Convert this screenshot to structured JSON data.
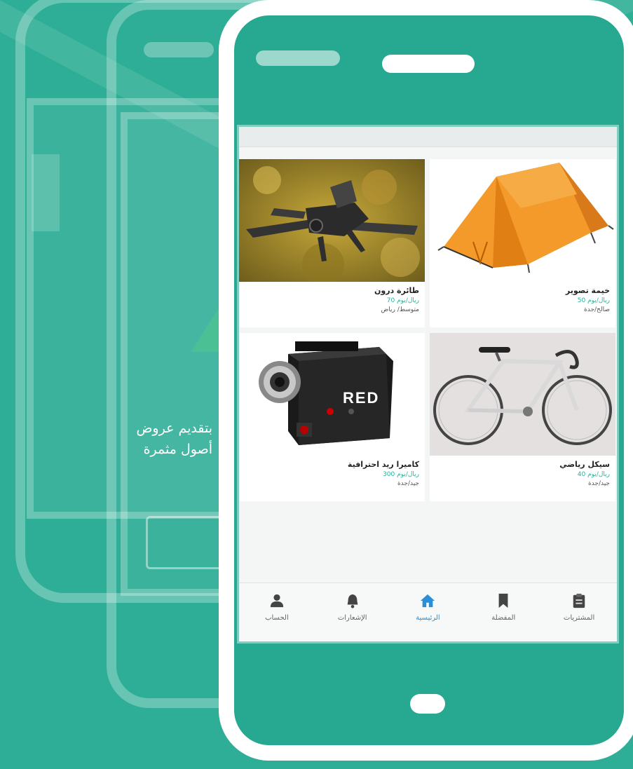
{
  "background_text": {
    "line1": "بتقديم عروض",
    "line2": "أصول مثمرة"
  },
  "products": [
    {
      "name": "طائرة درون",
      "price": "ريال/يوم 70",
      "condition": "متوسط/ رياض",
      "image": "drone-image"
    },
    {
      "name": "خيمة تصوير",
      "price": "ريال/يوم 50",
      "condition": "صالح/جدة",
      "image": "tent-image"
    },
    {
      "name": "كاميرا ريد احترافية",
      "price": "ريال/يوم 300",
      "condition": "جيد/جدة",
      "image": "red-camera-image"
    },
    {
      "name": "سيكل رياضي",
      "price": "ريال/يوم 40",
      "condition": "جيد/جدة",
      "image": "bicycle-image"
    }
  ],
  "camera_logo": "RED",
  "tabs": [
    {
      "label": "الحساب",
      "icon": "person-icon",
      "active": false
    },
    {
      "label": "الإشعارات",
      "icon": "bell-icon",
      "active": false
    },
    {
      "label": "الرئيسية",
      "icon": "home-icon",
      "active": true
    },
    {
      "label": "المفضلة",
      "icon": "bookmark-icon",
      "active": false
    },
    {
      "label": "المشتريات",
      "icon": "clipboard-icon",
      "active": false
    }
  ],
  "colors": {
    "background": "#2eae96",
    "accent": "#28b39b",
    "active_tab": "#2a8fd6"
  }
}
